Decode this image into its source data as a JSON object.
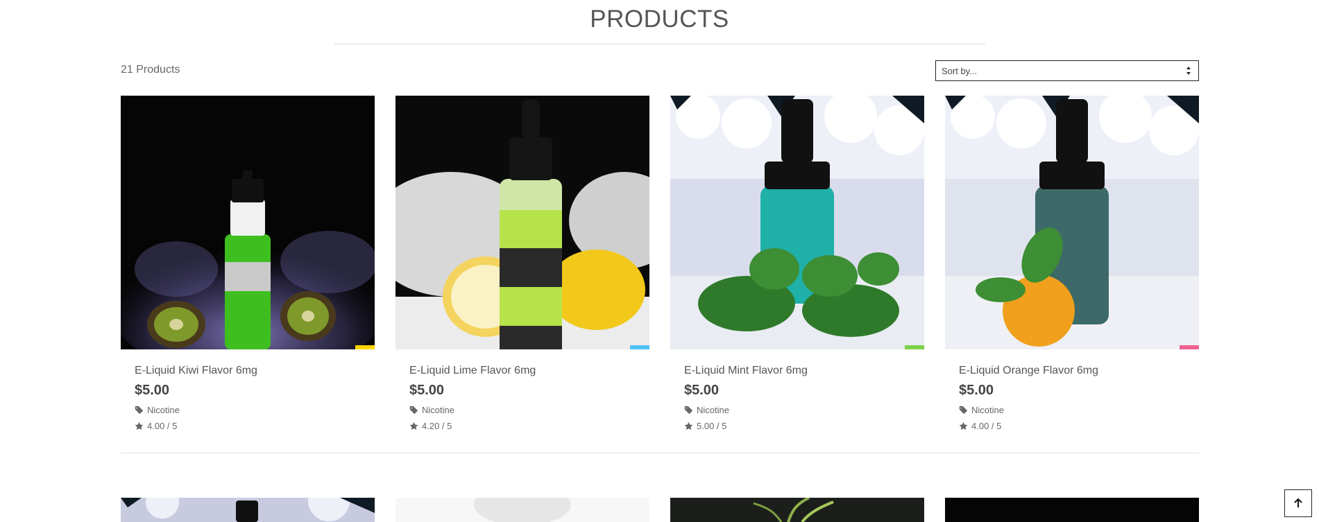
{
  "header": {
    "title": "PRODUCTS"
  },
  "toolbar": {
    "count_text": "21 Products",
    "sort_placeholder": "Sort by..."
  },
  "products": [
    {
      "name": "E-Liquid Kiwi Flavor 6mg",
      "price": "$5.00",
      "tag": "Nicotine",
      "rating": "4.00 / 5"
    },
    {
      "name": "E-Liquid Lime Flavor 6mg",
      "price": "$5.00",
      "tag": "Nicotine",
      "rating": "4.20 / 5"
    },
    {
      "name": "E-Liquid Mint Flavor 6mg",
      "price": "$5.00",
      "tag": "Nicotine",
      "rating": "5.00 / 5"
    },
    {
      "name": "E-Liquid Orange Flavor 6mg",
      "price": "$5.00",
      "tag": "Nicotine",
      "rating": "4.00 / 5"
    }
  ],
  "icons": {
    "tag": "tag-icon",
    "rating": "star-icon",
    "sort": "sort-arrows-icon",
    "back_to_top": "arrow-up-icon"
  }
}
